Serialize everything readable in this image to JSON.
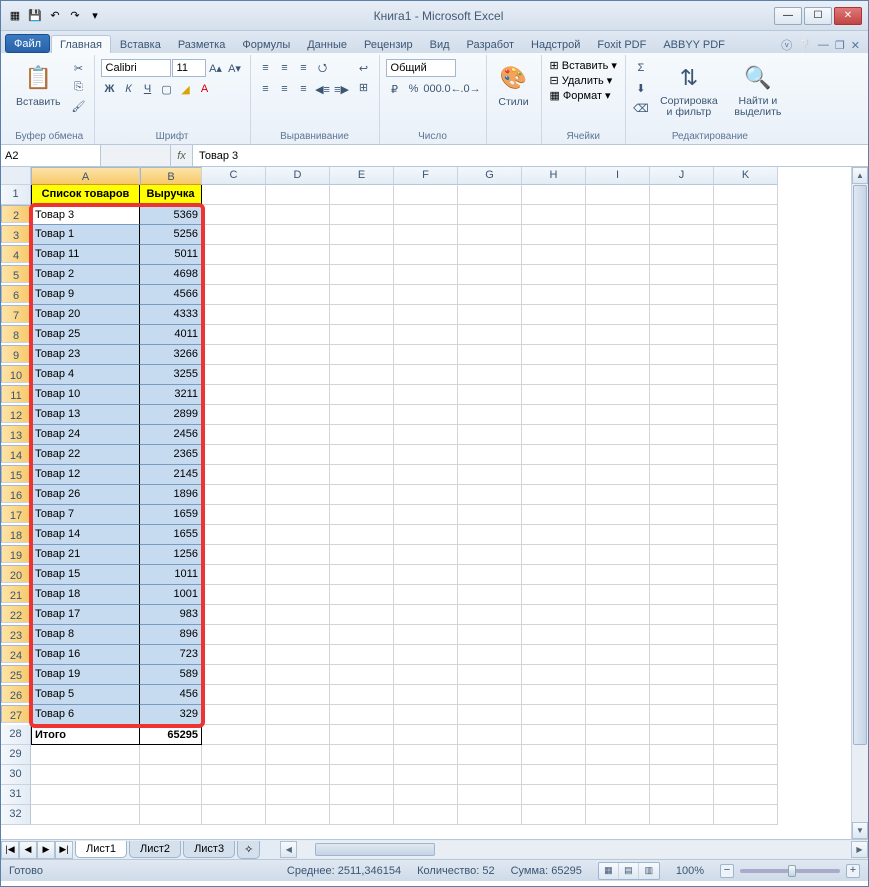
{
  "window": {
    "title": "Книга1 - Microsoft Excel"
  },
  "qat": [
    "save-icon",
    "undo-icon",
    "redo-icon",
    "open-icon"
  ],
  "tabs": {
    "file": "Файл",
    "items": [
      "Главная",
      "Вставка",
      "Разметка",
      "Формулы",
      "Данные",
      "Рецензир",
      "Вид",
      "Разработ",
      "Надстрой",
      "Foxit PDF",
      "ABBYY PDF"
    ],
    "active_index": 0
  },
  "ribbon": {
    "clipboard": {
      "paste": "Вставить",
      "label": "Буфер обмена"
    },
    "font": {
      "name": "Calibri",
      "size": "11",
      "label": "Шрифт"
    },
    "alignment": {
      "label": "Выравнивание"
    },
    "number": {
      "format": "Общий",
      "label": "Число"
    },
    "styles": {
      "btn": "Стили",
      "label": ""
    },
    "cells": {
      "insert": "Вставить",
      "delete": "Удалить",
      "format": "Формат",
      "label": "Ячейки"
    },
    "editing": {
      "sort": "Сортировка и фильтр",
      "find": "Найти и выделить",
      "label": "Редактирование"
    }
  },
  "namebox": "A2",
  "formula": "Товар 3",
  "columns": [
    "A",
    "B",
    "C",
    "D",
    "E",
    "F",
    "G",
    "H",
    "I",
    "J",
    "K"
  ],
  "headers": {
    "a": "Список товаров",
    "b": "Выручка"
  },
  "data_rows": [
    {
      "a": "Товар 3",
      "b": "5369"
    },
    {
      "a": "Товар 1",
      "b": "5256"
    },
    {
      "a": "Товар 11",
      "b": "5011"
    },
    {
      "a": "Товар 2",
      "b": "4698"
    },
    {
      "a": "Товар 9",
      "b": "4566"
    },
    {
      "a": "Товар 20",
      "b": "4333"
    },
    {
      "a": "Товар 25",
      "b": "4011"
    },
    {
      "a": "Товар 23",
      "b": "3266"
    },
    {
      "a": "Товар 4",
      "b": "3255"
    },
    {
      "a": "Товар 10",
      "b": "3211"
    },
    {
      "a": "Товар 13",
      "b": "2899"
    },
    {
      "a": "Товар 24",
      "b": "2456"
    },
    {
      "a": "Товар 22",
      "b": "2365"
    },
    {
      "a": "Товар 12",
      "b": "2145"
    },
    {
      "a": "Товар 26",
      "b": "1896"
    },
    {
      "a": "Товар 7",
      "b": "1659"
    },
    {
      "a": "Товар 14",
      "b": "1655"
    },
    {
      "a": "Товар 21",
      "b": "1256"
    },
    {
      "a": "Товар 15",
      "b": "1011"
    },
    {
      "a": "Товар 18",
      "b": "1001"
    },
    {
      "a": "Товар 17",
      "b": "983"
    },
    {
      "a": "Товар 8",
      "b": "896"
    },
    {
      "a": "Товар 16",
      "b": "723"
    },
    {
      "a": "Товар 19",
      "b": "589"
    },
    {
      "a": "Товар 5",
      "b": "456"
    },
    {
      "a": "Товар 6",
      "b": "329"
    }
  ],
  "total": {
    "label": "Итого",
    "value": "65295"
  },
  "sheets": [
    "Лист1",
    "Лист2",
    "Лист3"
  ],
  "status": {
    "ready": "Готово",
    "avg_label": "Среднее:",
    "avg": "2511,346154",
    "count_label": "Количество:",
    "count": "52",
    "sum_label": "Сумма:",
    "sum": "65295",
    "zoom": "100%"
  }
}
